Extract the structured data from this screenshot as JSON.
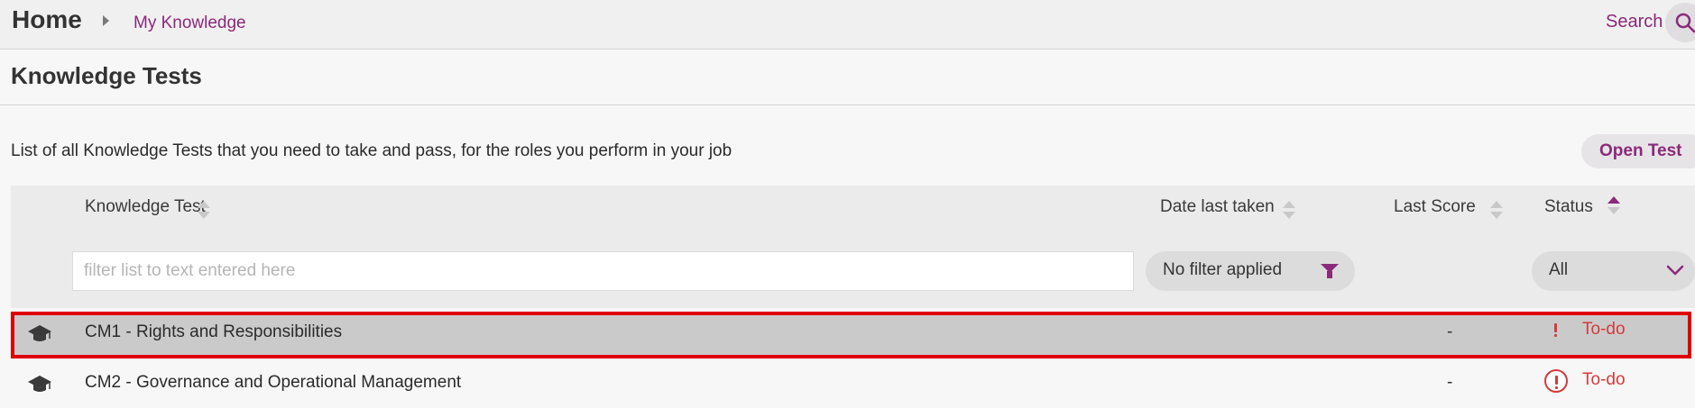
{
  "header": {
    "home_label": "Home",
    "breadcrumb": "My Knowledge",
    "search_label": "Search"
  },
  "page": {
    "title": "Knowledge Tests",
    "description": "List of all Knowledge Tests that you need to take and pass, for the roles you perform in your job",
    "open_test_label": "Open Test"
  },
  "table": {
    "columns": {
      "test": "Knowledge Test",
      "date": "Date last taken",
      "score": "Last Score",
      "status": "Status"
    },
    "sort": {
      "column": "status",
      "direction": "ascending"
    },
    "filters": {
      "text_placeholder": "filter list to text entered here",
      "date_filter": "No filter applied",
      "status_selected": "All"
    },
    "rows": [
      {
        "icon": "graduation-cap-icon",
        "name": "CM1 - Rights and Responsibilities",
        "date": "",
        "score": "-",
        "status": "To-do",
        "selected": true
      },
      {
        "icon": "graduation-cap-icon",
        "name": "CM2 - Governance and Operational Management",
        "date": "",
        "score": "-",
        "status": "To-do",
        "selected": false
      }
    ]
  },
  "colors": {
    "accent": "#8a2a7a",
    "todo": "#d43b3b",
    "highlight_border": "#e00000"
  }
}
